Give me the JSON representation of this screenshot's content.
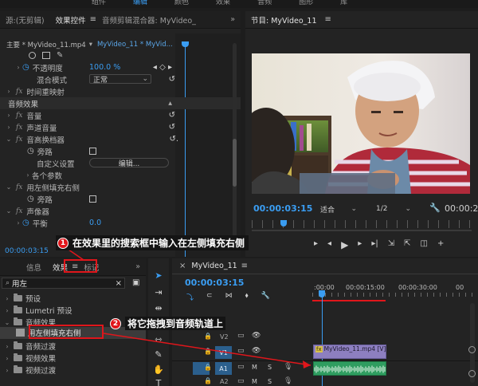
{
  "top_bar": {
    "items": [
      "组件",
      "编辑",
      "颜色",
      "效果",
      "音频",
      "图形",
      "库"
    ],
    "more": "»"
  },
  "left_panel": {
    "tabs": [
      "源:(无剪辑)",
      "效果控件",
      "音频剪辑混合器: MyVideo_"
    ],
    "menu": "≡",
    "more": "»",
    "clip_header": {
      "main": "主要 * MyVideo_11.mp4",
      "seq": "MyVideo_11 * MyVid..."
    },
    "rows": [
      {
        "label": "不透明度",
        "value": "100.0 %"
      },
      {
        "label": "混合模式",
        "value": "正常"
      },
      {
        "label": "时间重映射"
      },
      {
        "label": "音频效果"
      },
      {
        "label": "音量"
      },
      {
        "label": "声道音量"
      },
      {
        "label": "音高换档器"
      },
      {
        "label": "旁路"
      },
      {
        "label": "自定义设置",
        "button": "编辑..."
      },
      {
        "label": "各个参数"
      },
      {
        "label": "用左侧填充右侧"
      },
      {
        "label": "旁路"
      },
      {
        "label": "声像器"
      },
      {
        "label": "平衡",
        "value": "0.0"
      }
    ],
    "timecode": "00:00:03:15"
  },
  "program_monitor": {
    "title": "节目: MyVideo_11",
    "menu": "≡",
    "timecode": "00:00:03:15",
    "fit": "适合",
    "resolution": "1/2",
    "duration": "00:00:2"
  },
  "effects_panel": {
    "tabs": [
      "信息",
      "效果",
      "标记"
    ],
    "menu": "≡",
    "more": "»",
    "search_value": "用左",
    "items": [
      {
        "label": "预设"
      },
      {
        "label": "Lumetri 预设"
      },
      {
        "label": "音频效果"
      },
      {
        "label": "用左侧填充右侧"
      },
      {
        "label": "音频过渡"
      },
      {
        "label": "视频效果"
      },
      {
        "label": "视频过渡"
      }
    ]
  },
  "timeline": {
    "title": "MyVideo_11",
    "menu": "≡",
    "close": "×",
    "timecode": "00:00:03:15",
    "ruler": [
      ":00:00",
      "00:00:15:00",
      "00:00:30:00",
      "00"
    ],
    "tracks": [
      {
        "name": "V2",
        "kind": "video"
      },
      {
        "name": "V1",
        "kind": "video"
      },
      {
        "name": "A1",
        "kind": "audio",
        "m": "M",
        "s": "S"
      },
      {
        "name": "A2",
        "kind": "audio",
        "m": "M",
        "s": "S"
      }
    ],
    "clip_label": "MyVideo_11.mp4 [V] [120"
  },
  "annotations": [
    {
      "number": "1",
      "text": "在效果里的搜索框中输入在左侧填充右侧"
    },
    {
      "number": "2",
      "text": "将它拖拽到音频轨道上"
    }
  ],
  "colors": {
    "accent": "#3a9df2",
    "annotation_red": "#e0161b",
    "clip_purple": "#8d7fc0",
    "audio_green": "#2f9d60"
  }
}
